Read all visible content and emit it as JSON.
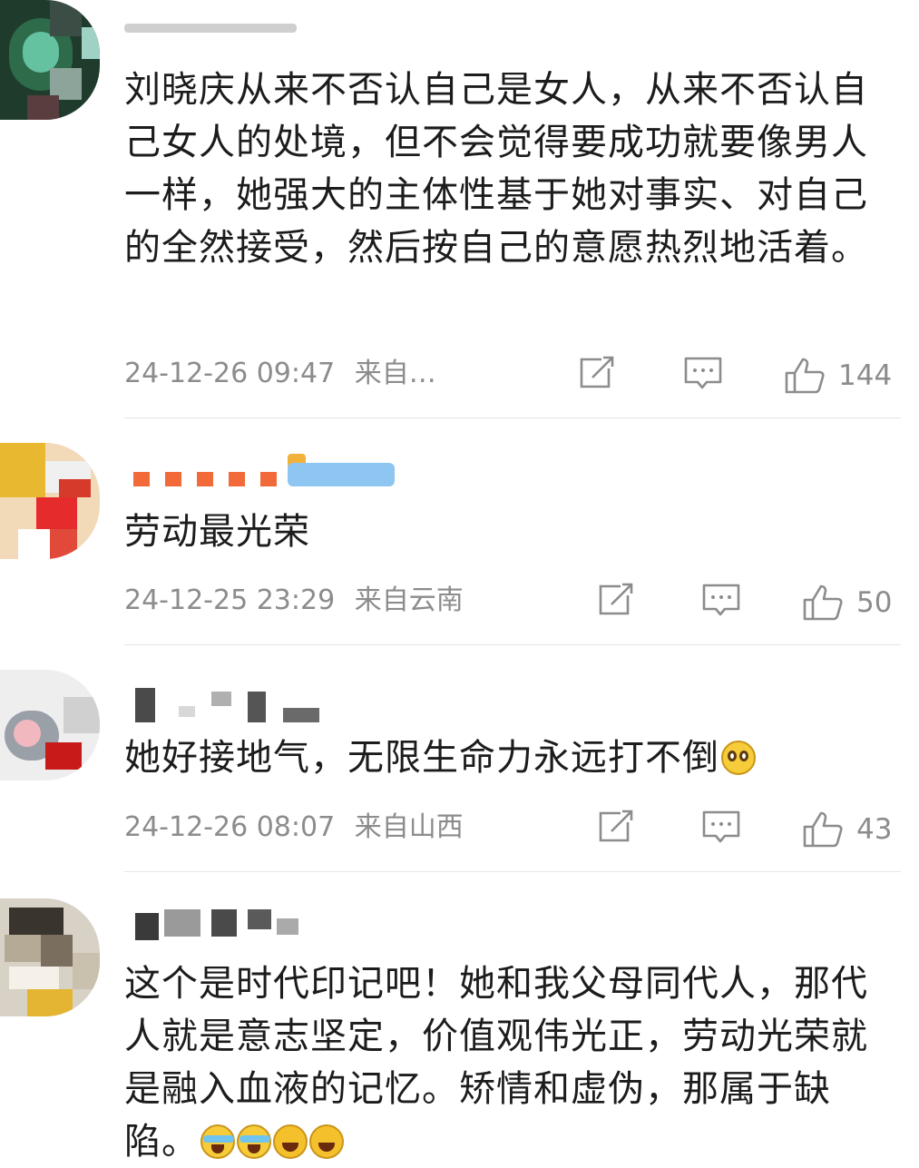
{
  "comments": [
    {
      "text": "刘晓庆从来不否认自己是女人，从来不否认自己女人的处境，但不会觉得要成功就要像男人一样，她强大的主体性基于她对事实、对自己的全然接受，然后按自己的意愿热烈地活着。",
      "date": "24-12-26 09:47",
      "location": "来自…",
      "likes": "144"
    },
    {
      "text": "劳动最光荣",
      "date": "24-12-25 23:29",
      "location": "来自云南",
      "likes": "50"
    },
    {
      "text": "她好接地气，无限生命力永远打不倒",
      "date": "24-12-26 08:07",
      "location": "来自山西",
      "likes": "43"
    },
    {
      "text": "这个是时代印记吧！她和我父母同代人，那代人就是意志坚定，价值观伟光正，劳动光荣就是融入血液的记忆。矫情和虚伪，那属于缺陷。",
      "date": "",
      "location": "",
      "likes": ""
    }
  ],
  "icons": [
    "share-icon",
    "reply-icon",
    "like-icon"
  ],
  "colors": {
    "meta": "#8c8c8c",
    "text": "#1c1c1c",
    "separator": "#e6e6e6"
  }
}
